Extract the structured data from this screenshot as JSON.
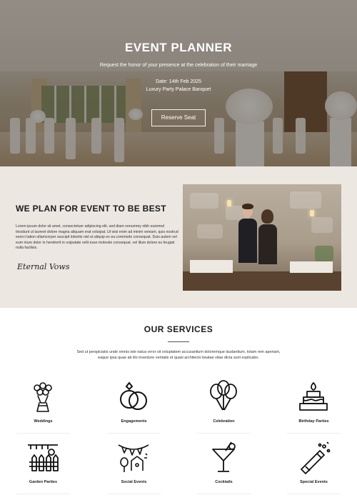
{
  "hero": {
    "title": "EVENT PLANNER",
    "subtitle": "Request the honor of your presence at the celebration of their marriage",
    "date": "Date: 14th Feb 2025",
    "venue": "Luxury Party Palace Banquet",
    "button_label": "Reserve Seat"
  },
  "about": {
    "title": "WE PLAN FOR EVENT TO BE BEST",
    "text": "Lorem ipsum dolor sit amet, consectetuer adipiscing elit, sed diam nonummy nibh euismod tincidunt ut laoreet dolore magna aliquam erat volutpat. Ut wisi enim ad minim veniam, quis nostrud exerci tation ullamcorper suscipit lobortis nisl ut aliquip ex ea commodo consequat. Duis autem vel eum iriure dolor in hendrerit in vulputate velit esse molestie consequat, vel illum dolore eu feugiat nulla facilisis.",
    "signature": "Eternal Vows"
  },
  "services": {
    "title": "OUR SERVICES",
    "description": "Sed ut perspiciatis unde omnis iste natus error sit voluptatem accusantium doloremque laudantium, totam rem aperiam, eaque ipsa quae ab illo inventore veritatis et quasi architecto beatae vitae dicta sunt explicabo.",
    "items": [
      {
        "label": "Weddings",
        "icon": "bouquet-icon"
      },
      {
        "label": "Engagements",
        "icon": "rings-icon"
      },
      {
        "label": "Celebration",
        "icon": "balloons-icon"
      },
      {
        "label": "Birthday Parties",
        "icon": "cake-icon"
      },
      {
        "label": "Garden Parties",
        "icon": "garden-fence-icon"
      },
      {
        "label": "Social Events",
        "icon": "bunting-icon"
      },
      {
        "label": "Cocktails",
        "icon": "cocktail-icon"
      },
      {
        "label": "Special Events",
        "icon": "champagne-icon"
      }
    ]
  },
  "colors": {
    "about_background": "#ece7e1",
    "hero_overlay": "#2d261e",
    "text_dark": "#1a1a1a"
  }
}
